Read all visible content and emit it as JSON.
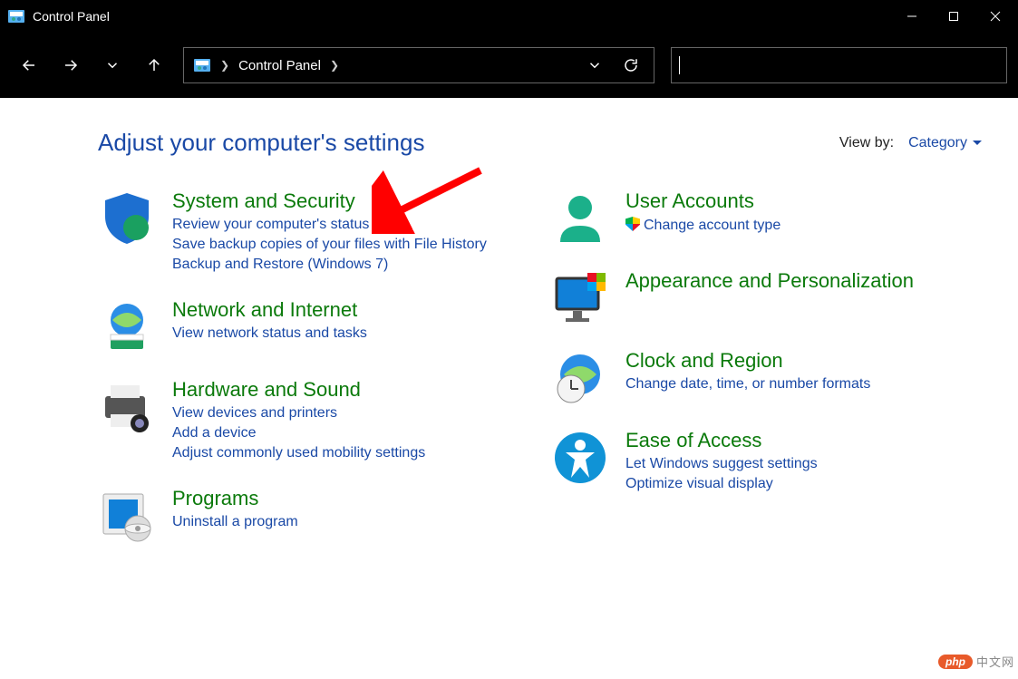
{
  "window": {
    "title": "Control Panel"
  },
  "breadcrumb": {
    "root": "Control Panel"
  },
  "header": {
    "page_title": "Adjust your computer's settings",
    "viewby_label": "View by:",
    "viewby_value": "Category"
  },
  "categories_left": [
    {
      "id": "system-and-security",
      "title": "System and Security",
      "links": [
        "Review your computer's status",
        "Save backup copies of your files with File History",
        "Backup and Restore (Windows 7)"
      ]
    },
    {
      "id": "network-and-internet",
      "title": "Network and Internet",
      "links": [
        "View network status and tasks"
      ]
    },
    {
      "id": "hardware-and-sound",
      "title": "Hardware and Sound",
      "links": [
        "View devices and printers",
        "Add a device",
        "Adjust commonly used mobility settings"
      ]
    },
    {
      "id": "programs",
      "title": "Programs",
      "links": [
        "Uninstall a program"
      ]
    }
  ],
  "categories_right": [
    {
      "id": "user-accounts",
      "title": "User Accounts",
      "links": [
        "Change account type"
      ],
      "link_shielded": [
        true
      ]
    },
    {
      "id": "appearance-and-personalization",
      "title": "Appearance and Personalization",
      "links": []
    },
    {
      "id": "clock-and-region",
      "title": "Clock and Region",
      "links": [
        "Change date, time, or number formats"
      ]
    },
    {
      "id": "ease-of-access",
      "title": "Ease of Access",
      "links": [
        "Let Windows suggest settings",
        "Optimize visual display"
      ]
    }
  ],
  "watermark": {
    "brand": "php",
    "text": "中文网"
  }
}
